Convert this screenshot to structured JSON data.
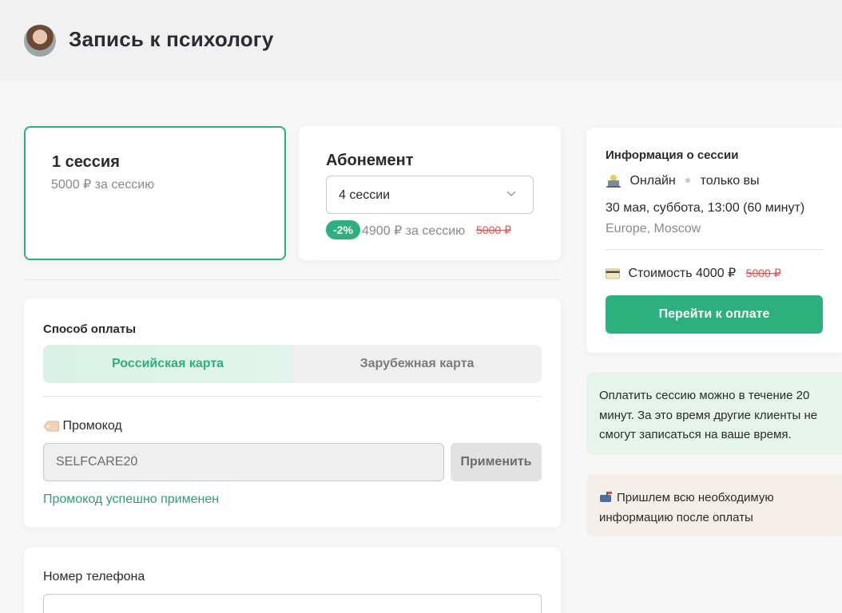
{
  "header": {
    "title": "Запись к психологу"
  },
  "tariffs": {
    "single": {
      "name": "1 сессия",
      "price": "5000 ₽ за сессию"
    },
    "subscription": {
      "name": "Абонемент",
      "select_value": "4 сессии",
      "discount_badge": "-2%",
      "price": "4900 ₽ за сессию",
      "old_price": "5000 ₽"
    }
  },
  "payment": {
    "method_label": "Способ оплаты",
    "options": [
      "Российская карта",
      "Зарубежная карта"
    ],
    "selected": "Российская карта",
    "promo_label": "Промокод",
    "promo_value": "SELFCARE20",
    "apply_button": "Применить",
    "promo_success": "Промокод успешно применен"
  },
  "contact": {
    "phone_label": "Номер телефона"
  },
  "session_info": {
    "title": "Информация о сессии",
    "format": "Онлайн",
    "participants": "только вы",
    "datetime": "30 мая, суббота, 13:00 (60 минут)",
    "timezone": "Europe, Moscow",
    "cost_label": "Стоимость 4000 ₽",
    "cost_old": "5000 ₽",
    "pay_button": "Перейти к оплате"
  },
  "notes": {
    "reservation": "Оплатить сессию можно в течение 20 минут. За это время другие клиенты не смогут записаться на ваше время.",
    "info": "Пришлем всю необходимую информацию после оплаты"
  },
  "colors": {
    "accent": "#2bb07e",
    "strike": "#d9534f",
    "note_green": "#e6f4ec",
    "note_peach": "#f6efe9"
  }
}
